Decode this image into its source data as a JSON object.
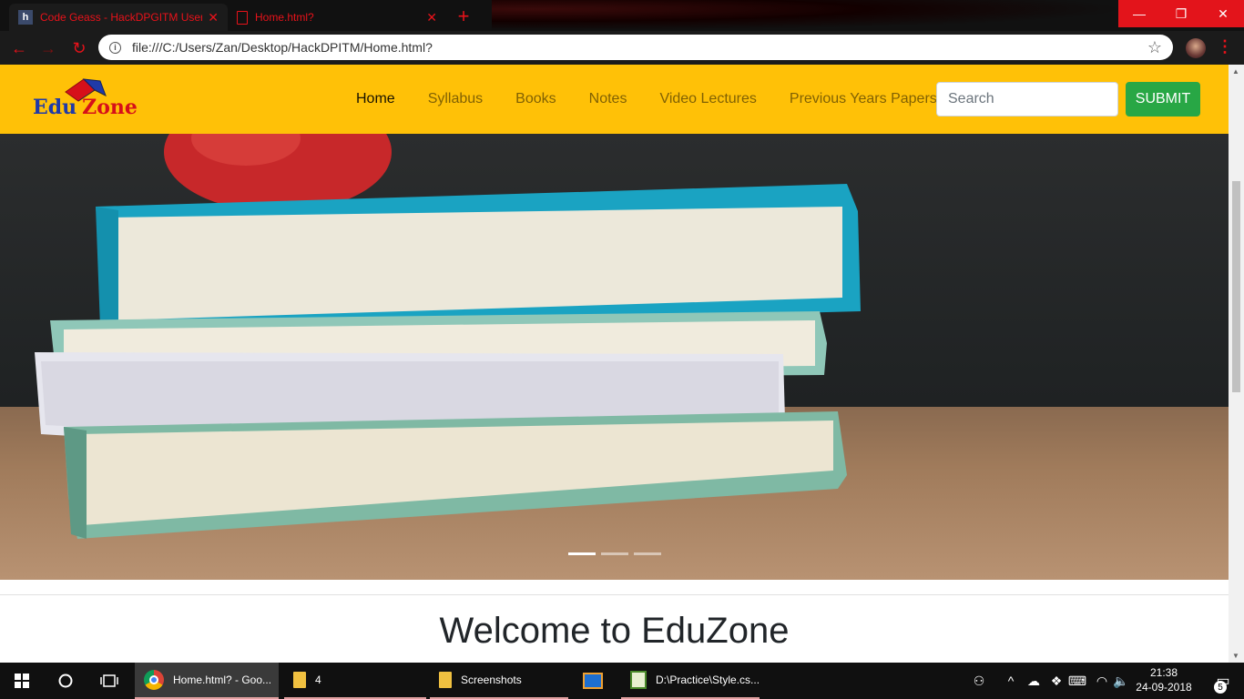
{
  "browser": {
    "tabs": [
      {
        "title": "Code Geass - HackDPGITM Users",
        "close": "✕"
      },
      {
        "title": "Home.html?",
        "close": "✕"
      }
    ],
    "new_tab": "+",
    "url": "file:///C:/Users/Zan/Desktop/HackDPITM/Home.html?",
    "icons": {
      "back": "←",
      "forward": "→",
      "reload": "↻",
      "info": "i",
      "star": "☆",
      "menu": "⋮",
      "minimize": "—",
      "maximize": "❐",
      "close": "✕"
    },
    "accent_color": "#e8121a"
  },
  "site": {
    "logo": {
      "edu": "Edu",
      "zone": "Zone"
    },
    "nav": [
      {
        "label": "Home",
        "active": true
      },
      {
        "label": "Syllabus",
        "active": false
      },
      {
        "label": "Books",
        "active": false
      },
      {
        "label": "Notes",
        "active": false
      },
      {
        "label": "Video Lectures",
        "active": false
      },
      {
        "label": "Previous Years Papers",
        "active": false
      }
    ],
    "search": {
      "placeholder": "Search",
      "value": ""
    },
    "submit_label": "SUBMIT",
    "carousel": {
      "slide_count": 3,
      "active_slide": 1
    },
    "welcome_heading": "Welcome to EduZone",
    "colors": {
      "navbar": "#ffc107",
      "submit": "#28a745"
    }
  },
  "taskbar": {
    "apps": [
      {
        "label": "Home.html? - Goo...",
        "icon": "chrome-icon"
      },
      {
        "label": "4",
        "icon": "folder-icon"
      },
      {
        "label": "Screenshots",
        "icon": "folder-icon"
      },
      {
        "label": "",
        "icon": "media-player-icon"
      },
      {
        "label": "D:\\Practice\\Style.cs...",
        "icon": "notepad-icon"
      }
    ],
    "clock": {
      "time": "21:38",
      "date": "24-09-2018"
    },
    "notification_count": "5"
  }
}
